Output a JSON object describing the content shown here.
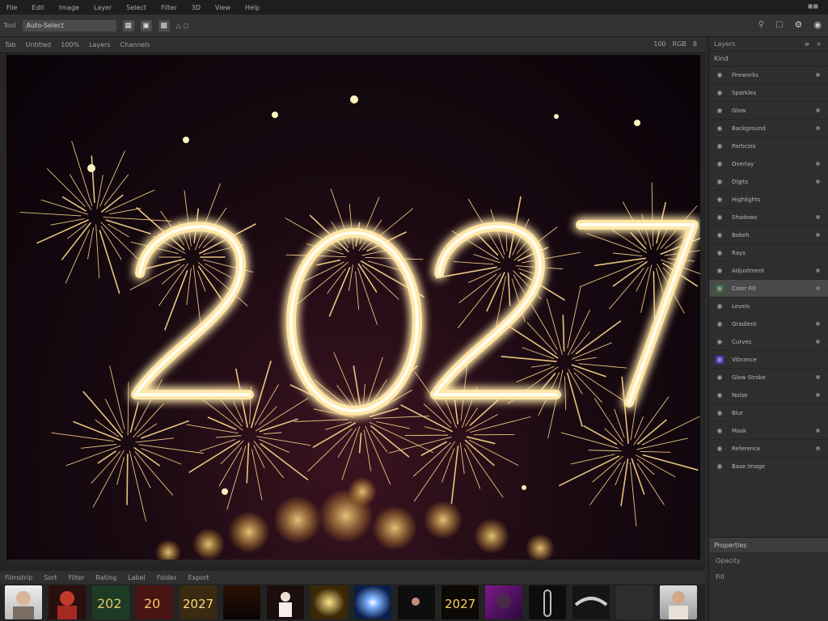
{
  "menubar": {
    "items": [
      "File",
      "Edit",
      "Image",
      "Layer",
      "Select",
      "Filter",
      "3D",
      "View",
      "Help"
    ],
    "right": ""
  },
  "toolbar": {
    "left_label": "Tool",
    "field_value": "Auto-Select",
    "right_items": [
      "",
      "",
      ""
    ]
  },
  "subbar": {
    "left_items": [
      "Tab",
      "Untitled",
      "100%",
      "Layers",
      "Channels"
    ],
    "right_items": [
      "100",
      "RGB",
      "8"
    ]
  },
  "canvas": {
    "year": "2027"
  },
  "right_panel": {
    "header": "Layers",
    "sub": "Kind",
    "layers": [
      {
        "label": "Fireworks",
        "style": ""
      },
      {
        "label": "Sparkles",
        "style": ""
      },
      {
        "label": "Glow",
        "style": ""
      },
      {
        "label": "Background",
        "style": ""
      },
      {
        "label": "Particles",
        "style": ""
      },
      {
        "label": "Overlay",
        "style": ""
      },
      {
        "label": "Digits",
        "style": ""
      },
      {
        "label": "Highlights",
        "style": ""
      },
      {
        "label": "Shadows",
        "style": ""
      },
      {
        "label": "Bokeh",
        "style": ""
      },
      {
        "label": "Rays",
        "style": ""
      },
      {
        "label": "Adjustment",
        "style": ""
      },
      {
        "label": "Color Fill",
        "style": "green sel"
      },
      {
        "label": "Levels",
        "style": ""
      },
      {
        "label": "Gradient",
        "style": ""
      },
      {
        "label": "Curves",
        "style": ""
      },
      {
        "label": "Vibrance",
        "style": "accent"
      },
      {
        "label": "Glow Stroke",
        "style": ""
      },
      {
        "label": "Noise",
        "style": ""
      },
      {
        "label": "Blur",
        "style": ""
      },
      {
        "label": "Mask",
        "style": ""
      },
      {
        "label": "Reference",
        "style": ""
      },
      {
        "label": "Base Image",
        "style": ""
      }
    ],
    "footer": {
      "title": "Properties",
      "row2": "Opacity",
      "row3": "Fill"
    }
  },
  "filmbar": {
    "items": [
      "Filmstrip",
      "Sort",
      "Filter",
      "Rating",
      "Label",
      "Folder",
      "Export"
    ]
  },
  "bottombar": {
    "status": ""
  },
  "thumbnails": [
    {
      "name": "thumb-portrait-1"
    },
    {
      "name": "thumb-red-figure"
    },
    {
      "name": "thumb-2027-green"
    },
    {
      "name": "thumb-2027-red"
    },
    {
      "name": "thumb-2027-gold"
    },
    {
      "name": "thumb-dark"
    },
    {
      "name": "thumb-figure-white"
    },
    {
      "name": "thumb-sparkle"
    },
    {
      "name": "thumb-blue-burst"
    },
    {
      "name": "thumb-small-object"
    },
    {
      "name": "thumb-2027-black"
    },
    {
      "name": "thumb-purple"
    },
    {
      "name": "thumb-chain"
    },
    {
      "name": "thumb-silver"
    },
    {
      "name": "thumb-empty"
    },
    {
      "name": "thumb-portrait-2"
    }
  ],
  "colors": {
    "gold": "#ffd36b",
    "glow": "#ffb93d",
    "bg_dark": "#080308",
    "accent": "#4a3fc9"
  }
}
